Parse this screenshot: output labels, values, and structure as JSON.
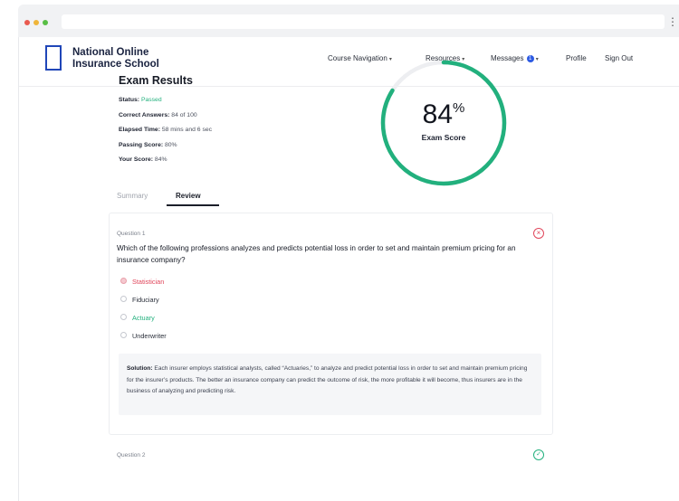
{
  "header": {
    "logo_line1": "National Online",
    "logo_line2": "Insurance School",
    "nav": {
      "course_navigation": "Course Navigation",
      "resources": "Resources",
      "messages": "Messages",
      "messages_count": "1",
      "profile": "Profile",
      "sign_out": "Sign Out"
    }
  },
  "results": {
    "title": "Exam Results",
    "status_label": "Status:",
    "status_value": "Passed",
    "correct_label": "Correct Answers:",
    "correct_value": "84 of 100",
    "elapsed_label": "Elapsed Time:",
    "elapsed_value": "58 mins and 6 sec",
    "passing_label": "Passing Score:",
    "passing_value": "80%",
    "your_label": "Your Score:",
    "your_value": "84%",
    "score_number": "84",
    "score_percent": "%",
    "score_fraction": 0.84,
    "score_label": "Exam Score"
  },
  "tabs": {
    "summary": "Summary",
    "review": "Review"
  },
  "question1": {
    "number": "Question 1",
    "text": "Which of the following professions analyzes and predicts potential loss in order to set and maintain premium pricing for an insurance company?",
    "options": [
      "Statistician",
      "Fiduciary",
      "Actuary",
      "Underwriter"
    ],
    "solution_label": "Solution:",
    "solution_text": "Each insurer employs statistical analysts, called “Actuaries,” to analyze and predict potential loss in order to set and maintain premium pricing for the insurer’s products. The better an insurance company can predict the outcome of risk, the more profitable it will become, thus insurers are in the business of analyzing and predicting risk."
  },
  "question2": {
    "number": "Question 2"
  },
  "colors": {
    "brand": "#2046b8",
    "correct": "#22b07d",
    "wrong": "#e0455a"
  }
}
